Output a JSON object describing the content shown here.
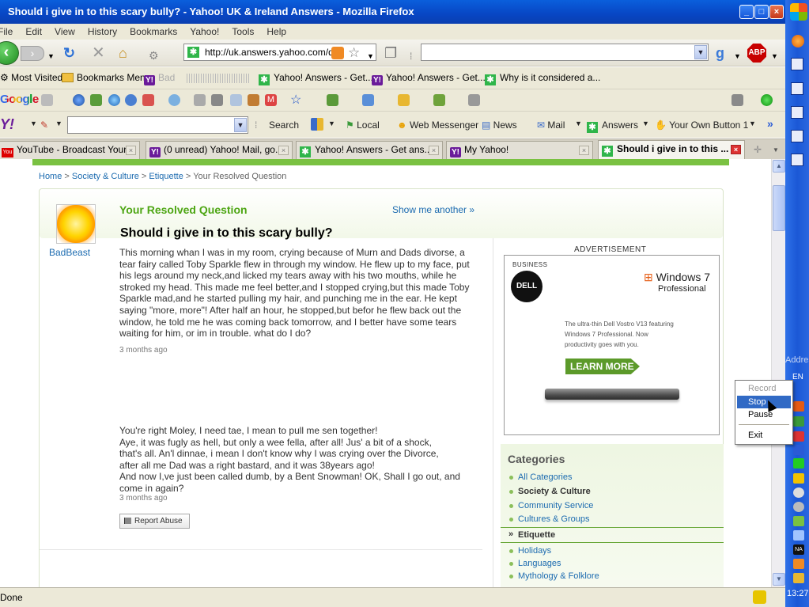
{
  "window": {
    "title": "Should i give in to this scary bully? - Yahoo! UK & Ireland Answers - Mozilla Firefox",
    "min": "_",
    "max": "□",
    "close": "×"
  },
  "menubar": {
    "items": [
      "File",
      "Edit",
      "View",
      "History",
      "Bookmarks",
      "Yahoo!",
      "Tools",
      "Help"
    ]
  },
  "navbar": {
    "url": "http://uk.answers.yahoo.com/q",
    "abp_label": "ABP"
  },
  "bookmarks": {
    "items": [
      {
        "label": "Most Visited",
        "icon": "gear-icon"
      },
      {
        "label": "Bookmarks Menu",
        "icon": "folder-icon"
      },
      {
        "label": "Bad",
        "icon": "yahoo-icon"
      },
      {
        "label": "Yahoo! Answers - Get...",
        "icon": "answers-icon"
      },
      {
        "label": "Yahoo! Answers - Get...",
        "icon": "yahoo-icon"
      },
      {
        "label": "Why is it considered a...",
        "icon": "answers-icon"
      }
    ]
  },
  "googlebar": {
    "logo": "Google"
  },
  "yahoobar": {
    "logo": "Y!",
    "items": [
      "Search",
      "Local",
      "Web Messenger",
      "News",
      "Mail",
      "Answers",
      "Your Own Button 1"
    ],
    "more": "»"
  },
  "tabs": [
    {
      "label": "YouTube - Broadcast Your...",
      "icon": "youtube-icon",
      "active": false
    },
    {
      "label": "(0 unread) Yahoo! Mail, go...",
      "icon": "yahoo-icon",
      "active": false
    },
    {
      "label": "Yahoo! Answers - Get ans...",
      "icon": "answers-icon",
      "active": false
    },
    {
      "label": "My Yahoo!",
      "icon": "yahoo-icon",
      "active": false
    },
    {
      "label": "Should i give in to this ...",
      "icon": "answers-icon",
      "active": true
    }
  ],
  "breadcrumb": {
    "home": "Home",
    "sep": " > ",
    "section": "Society & Culture",
    "sub": "Etiquette",
    "current": "Your Resolved Question"
  },
  "question": {
    "heading": "Your Resolved Question",
    "show_another": "Show me another »",
    "user": "BadBeast",
    "title": "Should i give in to this scary bully?",
    "body": "This morning whan I was in my room, crying because of Murn and Dads divorse, a tear fairy called Toby Sparkle flew in through my window. He flew up to my face, put his legs around my neck,and licked my tears away with his two mouths, while he stroked my head. This made me feel better,and I stopped crying,but this made Toby Sparkle mad,and he started pulling my hair, and punching me in the ear. He kept saying \"more, more\"! After half an hour, he stopped,but befor he flew back out the window, he told me he was coming back tomorrow, and I better have some tears waiting for him, or im in trouble. what do I do?",
    "time": "3 months ago"
  },
  "answer": {
    "body": "You're right Moley, I need tae, I mean to pull me sen together!\nAye, it was fugly as hell, but only a wee fella, after all! Jus' a bit of a shock,\nthat's all. An'l dinnae, i mean I don't know why I was crying over the Divorce,\nafter all me Dad was a right bastard, and it was 38years ago!\nAnd now I,ve just been called dumb, by a Bent Snowman! OK, Shall I go out, and\ncome in again?",
    "time": "3 months ago",
    "report": "Report Abuse"
  },
  "ad": {
    "label": "ADVERTISEMENT",
    "business": "BUSINESS",
    "dell": "DELL",
    "windows": "Windows 7",
    "professional": "Professional",
    "tagline": "The ultra-thin Dell Vostro V13 featuring Windows 7 Professional. Now productivity goes with you.",
    "cta": "LEARN MORE"
  },
  "categories": {
    "heading": "Categories",
    "items": [
      {
        "label": "All Categories",
        "style": "link"
      },
      {
        "label": "Society & Culture",
        "style": "selected"
      },
      {
        "label": "Community Service",
        "style": "link"
      },
      {
        "label": "Cultures & Groups",
        "style": "link"
      },
      {
        "label": "Etiquette",
        "style": "current"
      },
      {
        "label": "Holidays",
        "style": "link"
      },
      {
        "label": "Languages",
        "style": "link"
      },
      {
        "label": "Mythology & Folklore",
        "style": "link"
      }
    ]
  },
  "status": {
    "text": "Done"
  },
  "taskbar": {
    "address_label": "Address",
    "lang": "EN",
    "clock": "13:27"
  },
  "context_menu": {
    "items": [
      {
        "label": "Record",
        "state": "disabled"
      },
      {
        "label": "Stop",
        "state": "highlighted"
      },
      {
        "label": "Pause",
        "state": "normal"
      },
      {
        "label": "Exit",
        "state": "normal"
      }
    ]
  }
}
